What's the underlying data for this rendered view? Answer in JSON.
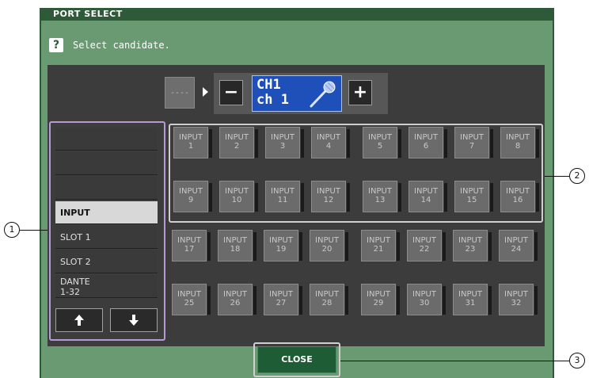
{
  "window": {
    "title": "PORT SELECT"
  },
  "help": {
    "icon": "?",
    "message": "Select candidate."
  },
  "patch": {
    "current_label": "----"
  },
  "channel": {
    "minus_label": "−",
    "plus_label": "+",
    "id": "CH1",
    "name": "ch 1",
    "icon": "microphone-icon"
  },
  "categories": [
    {
      "label": ""
    },
    {
      "label": ""
    },
    {
      "label": ""
    },
    {
      "label": "INPUT",
      "selected": true
    },
    {
      "label": "SLOT 1"
    },
    {
      "label": "SLOT 2"
    },
    {
      "label": "DANTE\n1-32"
    }
  ],
  "scroll": {
    "up_icon": "arrow-up-icon",
    "down_icon": "arrow-down-icon"
  },
  "ports": [
    {
      "label": "INPUT",
      "num": "1"
    },
    {
      "label": "INPUT",
      "num": "2"
    },
    {
      "label": "INPUT",
      "num": "3"
    },
    {
      "label": "INPUT",
      "num": "4"
    },
    {
      "label": "INPUT",
      "num": "5"
    },
    {
      "label": "INPUT",
      "num": "6"
    },
    {
      "label": "INPUT",
      "num": "7"
    },
    {
      "label": "INPUT",
      "num": "8"
    },
    {
      "label": "INPUT",
      "num": "9"
    },
    {
      "label": "INPUT",
      "num": "10"
    },
    {
      "label": "INPUT",
      "num": "11"
    },
    {
      "label": "INPUT",
      "num": "12"
    },
    {
      "label": "INPUT",
      "num": "13"
    },
    {
      "label": "INPUT",
      "num": "14"
    },
    {
      "label": "INPUT",
      "num": "15"
    },
    {
      "label": "INPUT",
      "num": "16"
    },
    {
      "label": "INPUT",
      "num": "17"
    },
    {
      "label": "INPUT",
      "num": "18"
    },
    {
      "label": "INPUT",
      "num": "19"
    },
    {
      "label": "INPUT",
      "num": "20"
    },
    {
      "label": "INPUT",
      "num": "21"
    },
    {
      "label": "INPUT",
      "num": "22"
    },
    {
      "label": "INPUT",
      "num": "23"
    },
    {
      "label": "INPUT",
      "num": "24"
    },
    {
      "label": "INPUT",
      "num": "25"
    },
    {
      "label": "INPUT",
      "num": "26"
    },
    {
      "label": "INPUT",
      "num": "27"
    },
    {
      "label": "INPUT",
      "num": "28"
    },
    {
      "label": "INPUT",
      "num": "29"
    },
    {
      "label": "INPUT",
      "num": "30"
    },
    {
      "label": "INPUT",
      "num": "31"
    },
    {
      "label": "INPUT",
      "num": "32"
    }
  ],
  "close": {
    "label": "CLOSE"
  },
  "callouts": {
    "one": "1",
    "two": "2",
    "three": "3"
  },
  "colors": {
    "window_bg": "#6a9a72",
    "title_bg": "#2f5a39",
    "channel_bg": "#1f4fb8",
    "close_bg": "#1e5c35"
  }
}
